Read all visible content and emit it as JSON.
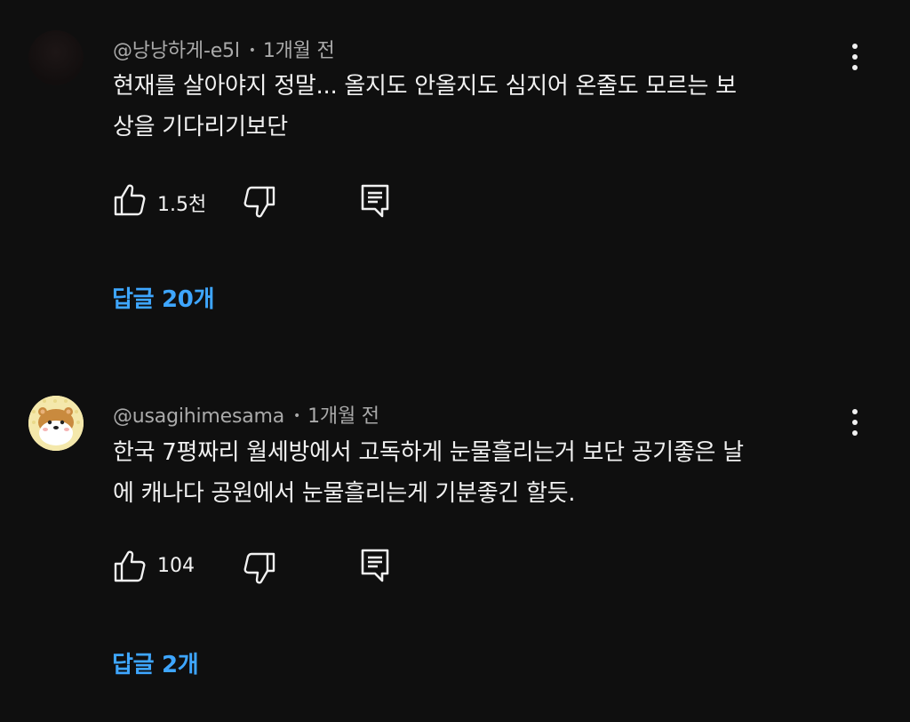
{
  "comments": [
    {
      "author": "@낭낭하게-e5l",
      "time": "1개월 전",
      "text_line1": "현재를 살아야지 정말... 올지도 안올지도 심지어 온줄도 모르는 보",
      "text_line2": "상을 기다리기보단",
      "likes": "1.5천",
      "replies_label": "답글 20개",
      "icons": [
        "thumb-up-icon",
        "thumb-down-icon",
        "reply-icon",
        "more-vert-icon"
      ]
    },
    {
      "author": "@usagihimesama",
      "time": "1개월 전",
      "text_line1": "한국 7평짜리 월세방에서 고독하게 눈물흘리는거 보단 공기좋은 날",
      "text_line2": "에 캐나다 공원에서 눈물흘리는게 기분좋긴 할듯.",
      "likes": "104",
      "replies_label": "답글 2개",
      "icons": [
        "thumb-up-icon",
        "thumb-down-icon",
        "reply-icon",
        "more-vert-icon"
      ]
    }
  ],
  "colors": {
    "background": "#0f0f0f",
    "text_primary": "#f1f1f1",
    "text_secondary": "#aaaaaa",
    "link": "#3ea6ff"
  }
}
